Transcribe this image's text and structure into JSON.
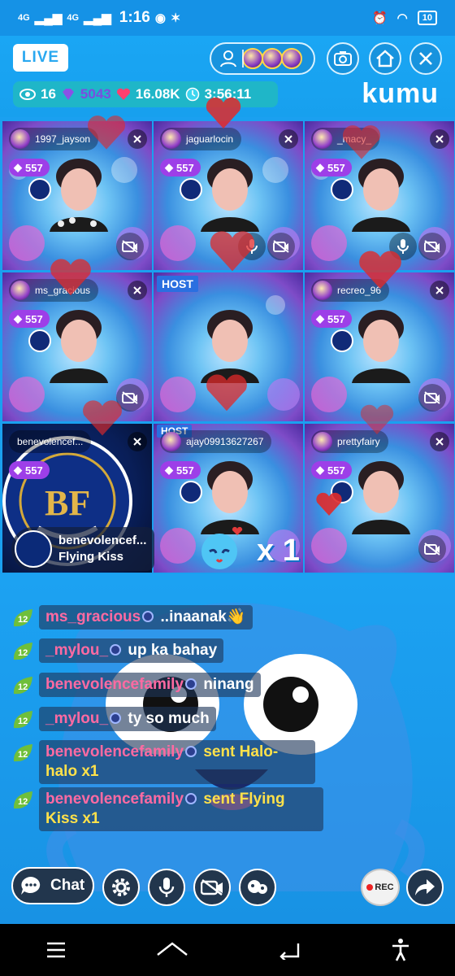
{
  "status_bar": {
    "net1": "4G",
    "net2": "4G",
    "time": "1:16",
    "battery": "10"
  },
  "header": {
    "live_label": "LIVE",
    "brand": "kumu",
    "stats": {
      "viewers": "16",
      "diamonds": "5043",
      "hearts": "16.08K",
      "duration": "3:56:11"
    }
  },
  "tiles": [
    {
      "name": "1997_jayson",
      "diamonds": "557"
    },
    {
      "name": "jaguarlocin",
      "diamonds": "557"
    },
    {
      "name": "_macy_",
      "diamonds": "557"
    },
    {
      "name": "ms_gracious",
      "diamonds": "557"
    },
    {
      "host_label": "HOST"
    },
    {
      "name": "recreo_96",
      "diamonds": "557"
    },
    {
      "name": "benevolencef...",
      "diamonds": "557"
    },
    {
      "name": "ajay09913627267",
      "diamonds": "557",
      "host_label": "HOST"
    },
    {
      "name": "prettyfairy",
      "diamonds": "557"
    }
  ],
  "gift_notice": {
    "user": "benevolencef...",
    "gift": "Flying Kiss",
    "count": "x 1"
  },
  "chat": [
    {
      "level": "12",
      "user": "ms_gracious",
      "text": "..inaanak👋"
    },
    {
      "level": "12",
      "user": "_mylou_",
      "text": "up ka bahay"
    },
    {
      "level": "12",
      "user": "benevolencefamily",
      "text": "ninang"
    },
    {
      "level": "12",
      "user": "_mylou_",
      "text": "ty so much"
    },
    {
      "level": "12",
      "user": "benevolencefamily",
      "gift": "sent Halo-halo x1"
    },
    {
      "level": "12",
      "user": "benevolencefamily",
      "gift": "sent Flying Kiss x1"
    }
  ],
  "toolbar": {
    "chat_label": "Chat",
    "rec_label": "REC"
  },
  "colors": {
    "accent": "#1aa0f0",
    "diamond": "#9d3fe8",
    "chat_user": "#ff6aa2",
    "gift_text": "#ffe14a"
  }
}
